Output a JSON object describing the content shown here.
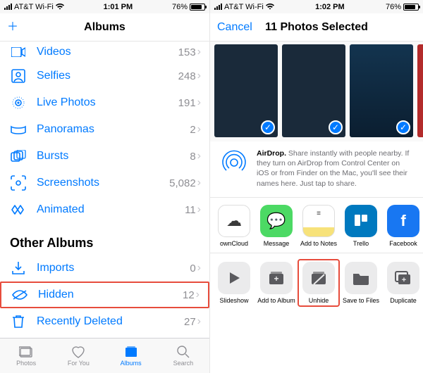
{
  "left": {
    "status": {
      "carrier": "AT&T Wi-Fi",
      "time": "1:01 PM",
      "battery": "76%"
    },
    "nav": {
      "title": "Albums"
    },
    "albums": [
      {
        "label": "Videos",
        "count": "153",
        "icon": "videos"
      },
      {
        "label": "Selfies",
        "count": "248",
        "icon": "selfies"
      },
      {
        "label": "Live Photos",
        "count": "191",
        "icon": "live"
      },
      {
        "label": "Panoramas",
        "count": "2",
        "icon": "pano"
      },
      {
        "label": "Bursts",
        "count": "8",
        "icon": "bursts"
      },
      {
        "label": "Screenshots",
        "count": "5,082",
        "icon": "screenshots"
      },
      {
        "label": "Animated",
        "count": "11",
        "icon": "animated"
      }
    ],
    "other_section": "Other Albums",
    "other_albums": [
      {
        "label": "Imports",
        "count": "0",
        "icon": "imports"
      },
      {
        "label": "Hidden",
        "count": "12",
        "icon": "hidden",
        "highlighted": true
      },
      {
        "label": "Recently Deleted",
        "count": "27",
        "icon": "trash"
      }
    ],
    "tabs": [
      {
        "label": "Photos"
      },
      {
        "label": "For You"
      },
      {
        "label": "Albums"
      },
      {
        "label": "Search"
      }
    ]
  },
  "right": {
    "status": {
      "carrier": "AT&T Wi-Fi",
      "time": "1:02 PM",
      "battery": "76%"
    },
    "nav": {
      "cancel": "Cancel",
      "title": "11 Photos Selected"
    },
    "airdrop": {
      "title": "AirDrop.",
      "body": "Share instantly with people nearby. If they turn on AirDrop from Control Center on iOS or from Finder on the Mac, you'll see their names here. Just tap to share."
    },
    "share_apps": [
      {
        "label": "ownCloud",
        "color": "#ffffff",
        "text_color": "#444"
      },
      {
        "label": "Message",
        "color": "#4cd964"
      },
      {
        "label": "Add to Notes",
        "color": "#ffffff",
        "text_color": "#f5b400"
      },
      {
        "label": "Trello",
        "color": "#0079bf"
      },
      {
        "label": "Facebook",
        "color": "#1877f2"
      }
    ],
    "actions": [
      {
        "label": "Slideshow"
      },
      {
        "label": "Add to Album"
      },
      {
        "label": "Unhide",
        "highlighted": true
      },
      {
        "label": "Save to Files"
      },
      {
        "label": "Duplicate"
      }
    ]
  }
}
